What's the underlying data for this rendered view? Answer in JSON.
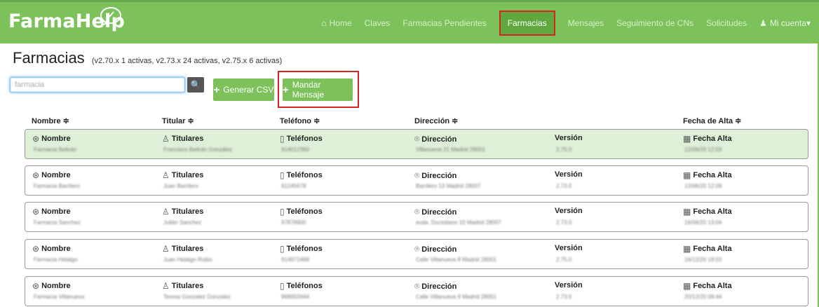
{
  "app": {
    "logo_text": "FarmaHelp"
  },
  "nav": {
    "home": "Home",
    "claves": "Claves",
    "pendientes": "Farmacias Pendientes",
    "farmacias": "Farmacias",
    "mensajes": "Mensajes",
    "seguimiento": "Seguimiento de CNs",
    "solicitudes": "Solicitudes",
    "cuenta": "Mi cuenta"
  },
  "page": {
    "title": "Farmacias",
    "subtitle": "(v2.70.x 1 activas, v2.73.x 24 activas, v2.75.x 6 activas)"
  },
  "search": {
    "value": "farmacia"
  },
  "buttons": {
    "csv": "Generar CSV",
    "msg": "Mandar Mensaje"
  },
  "columns": {
    "nombre": "Nombre ≑",
    "titular": "Titular ≑",
    "telefono": "Teléfono ≑",
    "direccion": "Dirección ≑",
    "fecha": "Fecha de Alta ≑"
  },
  "labels": {
    "nombre": "Nombre",
    "titulares": "Titulares",
    "telefonos": "Teléfonos",
    "direccion": "Dirección",
    "version": "Versión",
    "fecha": "Fecha Alta"
  },
  "rows": [
    {
      "nombre": "Farmacia Beltrán",
      "titular": "Francisco Beltrán González",
      "telefono": "914012360",
      "direccion": "Villanueva 21 Madrid 28001",
      "version": "2.75.0",
      "fecha": "12/06/20 12:03"
    },
    {
      "nombre": "Farmacia Barrilero",
      "titular": "Juan Barrilero",
      "telefono": "91245678",
      "direccion": "Barrilero 13 Madrid 28007",
      "version": "2.73.0",
      "fecha": "12/06/20 12:09"
    },
    {
      "nombre": "Farmacia Sanchez",
      "titular": "Julián Sanchez",
      "telefono": "97878900",
      "direccion": "avda. Doctoliano 10 Madrid 28007",
      "version": "2.73.0",
      "fecha": "16/06/20 13:04"
    },
    {
      "nombre": "Farmacia Hidalgo",
      "titular": "Juan Hidalgo Rubio",
      "telefono": "914672498",
      "direccion": "Calle Villanueva 8 Madrid 28001",
      "version": "2.75.0",
      "fecha": "16/12/20 18:03"
    },
    {
      "nombre": "Farmacia Villanueva",
      "titular": "Teresa Gonzalez Gonzalez",
      "telefono": "968003444",
      "direccion": "Calle Villanueva 9 Madrid 28001",
      "version": "2.73.0",
      "fecha": "20/12/20 09:44"
    }
  ]
}
